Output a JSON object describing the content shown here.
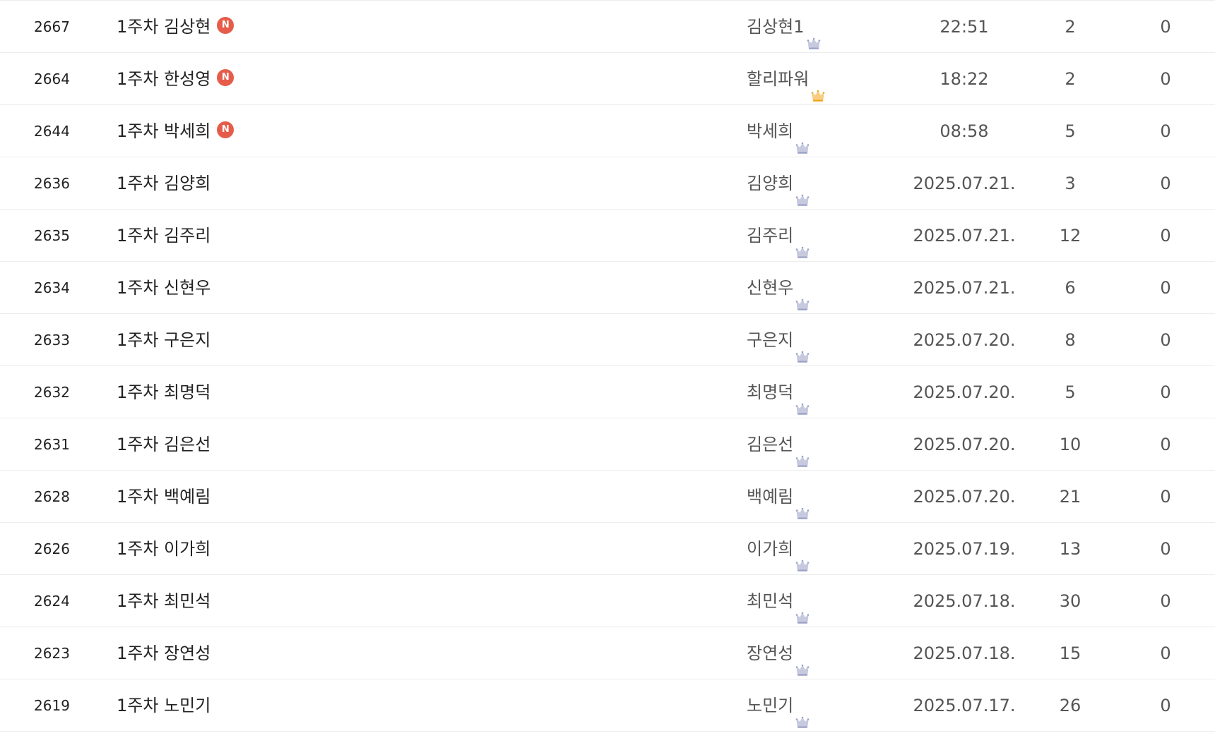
{
  "board": {
    "new_badge_text": "N",
    "colors": {
      "new_badge": "#e65c4a",
      "grade_silver": "#9aa0c6",
      "grade_gold": "#f3a31b"
    },
    "rows": [
      {
        "num": "2667",
        "title": "1주차 김상현",
        "is_new": true,
        "author": "김상현1",
        "grade_icon": "crown-silver-icon",
        "date": "22:51",
        "views": "2",
        "likes": "0"
      },
      {
        "num": "2664",
        "title": "1주차 한성영",
        "is_new": true,
        "author": "할리파워",
        "grade_icon": "crown-gold-icon",
        "date": "18:22",
        "views": "2",
        "likes": "0"
      },
      {
        "num": "2644",
        "title": "1주차 박세희",
        "is_new": true,
        "author": "박세희",
        "grade_icon": "crown-silver-icon",
        "date": "08:58",
        "views": "5",
        "likes": "0"
      },
      {
        "num": "2636",
        "title": "1주차 김양희",
        "is_new": false,
        "author": "김양희",
        "grade_icon": "crown-silver-icon",
        "date": "2025.07.21.",
        "views": "3",
        "likes": "0"
      },
      {
        "num": "2635",
        "title": "1주차 김주리",
        "is_new": false,
        "author": "김주리",
        "grade_icon": "crown-silver-icon",
        "date": "2025.07.21.",
        "views": "12",
        "likes": "0"
      },
      {
        "num": "2634",
        "title": "1주차 신현우",
        "is_new": false,
        "author": "신현우",
        "grade_icon": "crown-silver-icon",
        "date": "2025.07.21.",
        "views": "6",
        "likes": "0"
      },
      {
        "num": "2633",
        "title": "1주차 구은지",
        "is_new": false,
        "author": "구은지",
        "grade_icon": "crown-silver-icon",
        "date": "2025.07.20.",
        "views": "8",
        "likes": "0"
      },
      {
        "num": "2632",
        "title": "1주차 최명덕",
        "is_new": false,
        "author": "최명덕",
        "grade_icon": "crown-silver-icon",
        "date": "2025.07.20.",
        "views": "5",
        "likes": "0"
      },
      {
        "num": "2631",
        "title": "1주차 김은선",
        "is_new": false,
        "author": "김은선",
        "grade_icon": "crown-silver-icon",
        "date": "2025.07.20.",
        "views": "10",
        "likes": "0"
      },
      {
        "num": "2628",
        "title": "1주차 백예림",
        "is_new": false,
        "author": "백예림",
        "grade_icon": "crown-silver-icon",
        "date": "2025.07.20.",
        "views": "21",
        "likes": "0"
      },
      {
        "num": "2626",
        "title": "1주차 이가희",
        "is_new": false,
        "author": "이가희",
        "grade_icon": "crown-silver-icon",
        "date": "2025.07.19.",
        "views": "13",
        "likes": "0"
      },
      {
        "num": "2624",
        "title": "1주차 최민석",
        "is_new": false,
        "author": "최민석",
        "grade_icon": "crown-silver-icon",
        "date": "2025.07.18.",
        "views": "30",
        "likes": "0"
      },
      {
        "num": "2623",
        "title": "1주차 장연성",
        "is_new": false,
        "author": "장연성",
        "grade_icon": "crown-silver-icon",
        "date": "2025.07.18.",
        "views": "15",
        "likes": "0"
      },
      {
        "num": "2619",
        "title": "1주차 노민기",
        "is_new": false,
        "author": "노민기",
        "grade_icon": "crown-silver-icon",
        "date": "2025.07.17.",
        "views": "26",
        "likes": "0"
      }
    ]
  }
}
